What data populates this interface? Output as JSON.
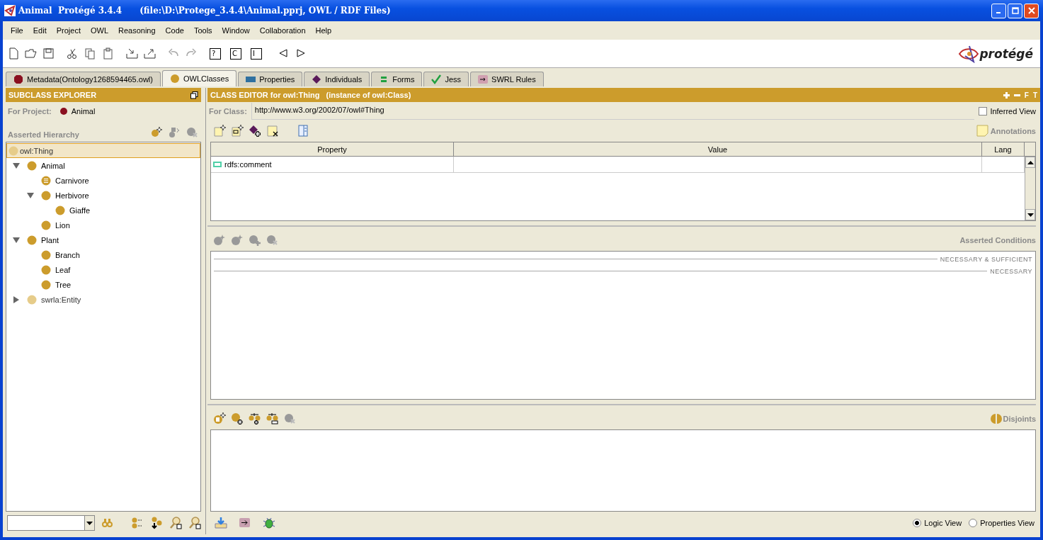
{
  "window": {
    "title": "Animal  Protégé 3.4.4      (file:\\D:\\Protege_3.4.4\\Animal.pprj, OWL / RDF Files)"
  },
  "menu": [
    "File",
    "Edit",
    "Project",
    "OWL",
    "Reasoning",
    "Code",
    "Tools",
    "Window",
    "Collaboration",
    "Help"
  ],
  "query_buttons": [
    "?",
    "C",
    "I"
  ],
  "logo": "protégé",
  "tabs": [
    {
      "label": "Metadata(Ontology1268594465.owl)",
      "kind": "metadata",
      "selected": false
    },
    {
      "label": "OWLClasses",
      "kind": "classes",
      "selected": true
    },
    {
      "label": "Properties",
      "kind": "properties",
      "selected": false
    },
    {
      "label": "Individuals",
      "kind": "individuals",
      "selected": false
    },
    {
      "label": "Forms",
      "kind": "forms",
      "selected": false
    },
    {
      "label": "Jess",
      "kind": "jess",
      "selected": false
    },
    {
      "label": "SWRL Rules",
      "kind": "swrl",
      "selected": false
    }
  ],
  "subclass_explorer": {
    "title": "SUBCLASS EXPLORER",
    "project_label": "For Project:",
    "project_name": "Animal",
    "hierarchy_title": "Asserted Hierarchy",
    "tree": [
      {
        "label": "owl:Thing",
        "kind": "meta",
        "selected": true,
        "children": [
          {
            "label": "Animal",
            "kind": "primitive",
            "selected": false,
            "expanded": true,
            "children": [
              {
                "label": "Carnivore",
                "kind": "defined",
                "selected": false
              },
              {
                "label": "Herbivore",
                "kind": "primitive",
                "selected": false,
                "expanded": true,
                "children": [
                  {
                    "label": "Giaffe",
                    "kind": "primitive",
                    "selected": false
                  }
                ]
              },
              {
                "label": "Lion",
                "kind": "primitive",
                "selected": false
              }
            ]
          },
          {
            "label": "Plant",
            "kind": "primitive",
            "selected": false,
            "expanded": true,
            "children": [
              {
                "label": "Branch",
                "kind": "primitive",
                "selected": false
              },
              {
                "label": "Leaf",
                "kind": "primitive",
                "selected": false
              },
              {
                "label": "Tree",
                "kind": "primitive",
                "selected": false
              }
            ]
          },
          {
            "label": "swrla:Entity",
            "kind": "meta",
            "selected": false,
            "expanded": false
          }
        ]
      }
    ]
  },
  "class_editor": {
    "title": "CLASS EDITOR for owl:Thing   (instance of owl:Class)",
    "header_buttons": [
      "F",
      "T"
    ],
    "for_class_label": "For Class:",
    "for_class_value": "http://www.w3.org/2002/07/owl#Thing",
    "inferred_view": {
      "label": "Inferred View",
      "checked": false
    },
    "annotations_title": "Annotations",
    "annotation_columns": [
      "Property",
      "Value",
      "Lang"
    ],
    "annotation_rows": [
      {
        "property": "rdfs:comment"
      }
    ],
    "conditions_title": "Asserted Conditions",
    "condition_sections": [
      "NECESSARY & SUFFICIENT",
      "NECESSARY"
    ],
    "disjoints_title": "Disjoints",
    "views": [
      {
        "label": "Logic View",
        "selected": true
      },
      {
        "label": "Properties View",
        "selected": false
      }
    ]
  }
}
